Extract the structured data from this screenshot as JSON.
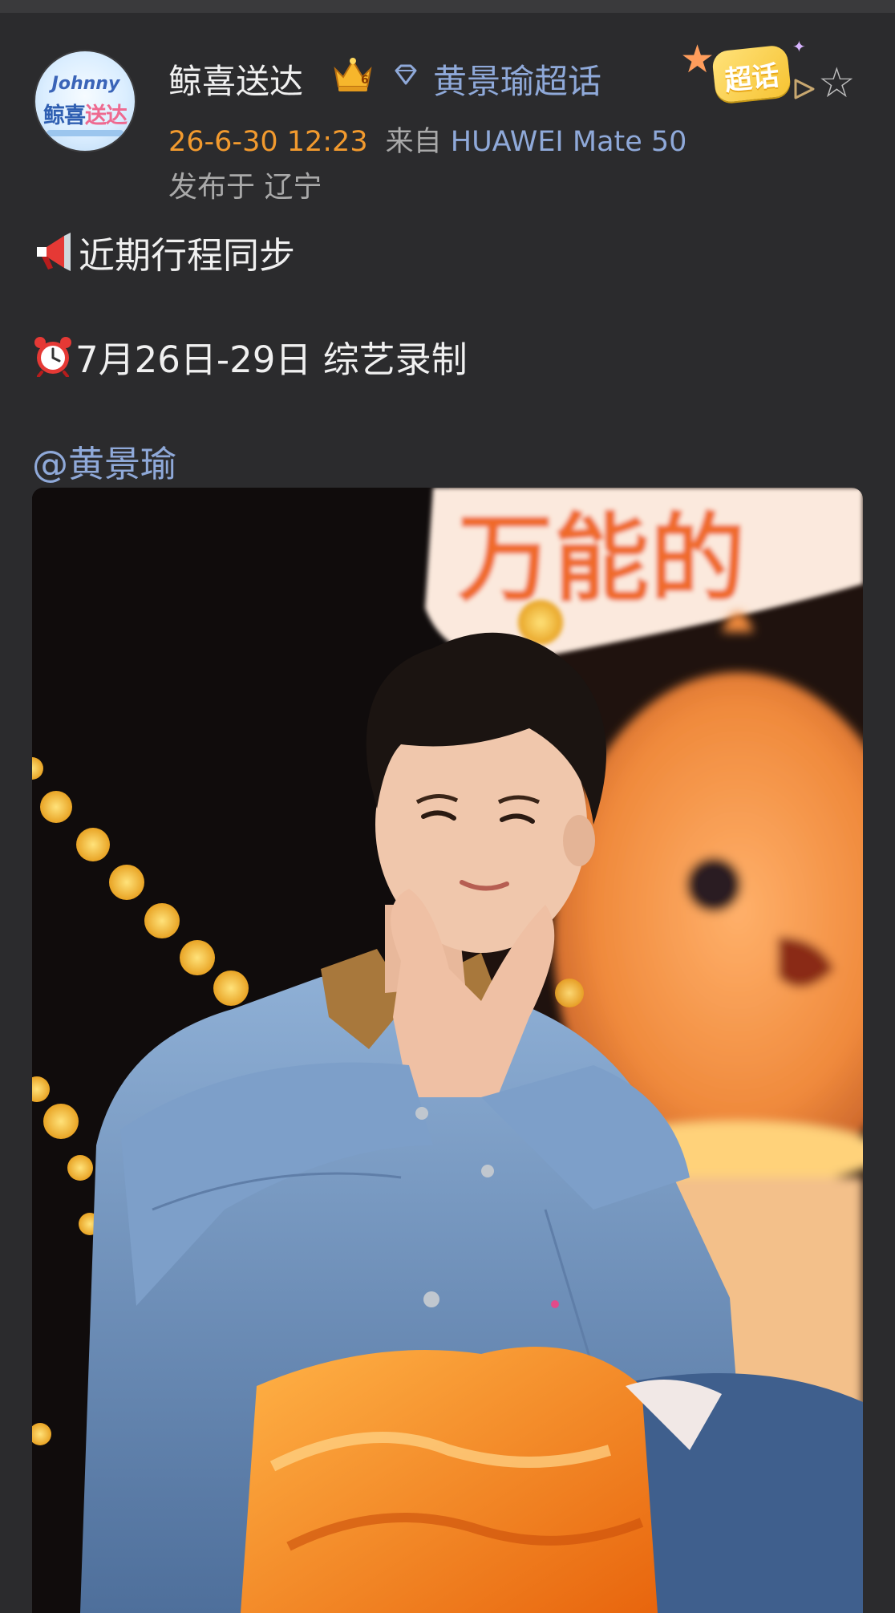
{
  "post": {
    "author": {
      "name": "鲸喜送达",
      "avatar_text_en": "Johnny",
      "avatar_text_cn_a": "鲸喜",
      "avatar_text_cn_b": "送达",
      "badge_level": "6"
    },
    "topic": "黄景瑜超话",
    "supertopic_badge": "超话",
    "timestamp": "26-6-30 12:23",
    "source_prefix": "来自",
    "device": "HUAWEI Mate 50",
    "location": "发布于 辽宁",
    "lines": [
      {
        "emoji": "megaphone-icon",
        "text": "近期行程同步"
      },
      {
        "emoji": "alarm-clock-icon",
        "text": "7月26日-29日 综艺录制"
      }
    ],
    "mention": "@黄景瑜",
    "photo": {
      "sign_text": "万能的"
    }
  },
  "colors": {
    "background": "#2b2b2d",
    "link": "#8fa9d9",
    "timestamp": "#f29a2e",
    "muted": "#a9a9a9",
    "text": "#f0f0f0"
  }
}
